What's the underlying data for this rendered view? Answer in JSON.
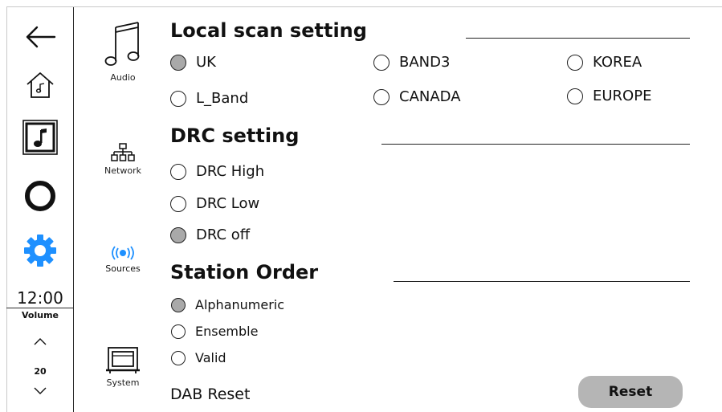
{
  "rail": {
    "icons": [
      "back-arrow-icon",
      "home-music-icon",
      "music-note-icon",
      "alexa-ring-icon",
      "gear-icon"
    ],
    "clock": "12:00",
    "volume_label": "Volume",
    "volume_value": "20",
    "accent_color": "#1e90ff"
  },
  "categories": [
    {
      "label": "Audio",
      "icon": "music-notes-icon"
    },
    {
      "label": "Network",
      "icon": "network-icon"
    },
    {
      "label": "Sources",
      "icon": "broadcast-icon",
      "active": true
    },
    {
      "label": "System",
      "icon": "system-device-icon"
    }
  ],
  "local_scan": {
    "title": "Local scan setting",
    "options": [
      {
        "label": "UK",
        "selected": true
      },
      {
        "label": "BAND3",
        "selected": false
      },
      {
        "label": "KOREA",
        "selected": false
      },
      {
        "label": "L_Band",
        "selected": false
      },
      {
        "label": "CANADA",
        "selected": false
      },
      {
        "label": "EUROPE",
        "selected": false
      }
    ]
  },
  "drc": {
    "title": "DRC setting",
    "options": [
      {
        "label": "DRC High",
        "selected": false
      },
      {
        "label": "DRC Low",
        "selected": false
      },
      {
        "label": "DRC off",
        "selected": true
      }
    ]
  },
  "station_order": {
    "title": "Station Order",
    "options": [
      {
        "label": "Alphanumeric",
        "selected": true
      },
      {
        "label": "Ensemble",
        "selected": false
      },
      {
        "label": "Valid",
        "selected": false
      }
    ]
  },
  "dab_reset": {
    "label": "DAB Reset",
    "button": "Reset"
  }
}
